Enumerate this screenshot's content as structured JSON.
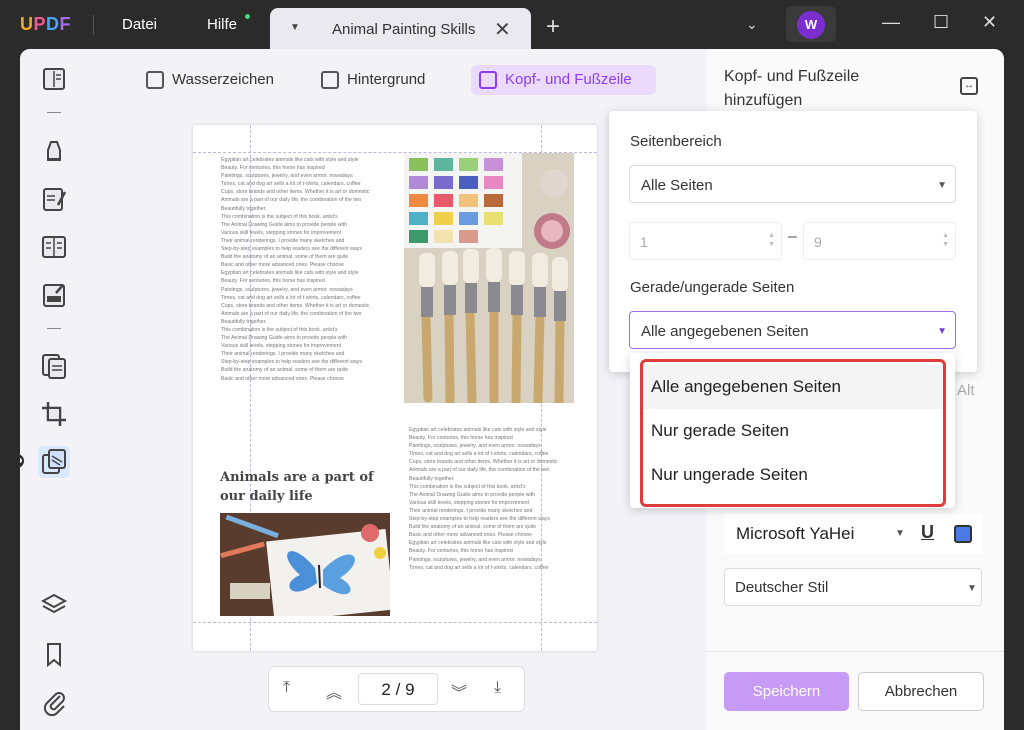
{
  "app": {
    "logo": "UPDF",
    "menu": [
      "Datei",
      "Hilfe"
    ],
    "tab_title": "Animal Painting Skills",
    "user_initial": "W"
  },
  "toolbar": {
    "watermark": "Wasserzeichen",
    "background": "Hintergrund",
    "header_footer": "Kopf- und Fußzeile"
  },
  "colors": {
    "accent": "#8a3ff0",
    "highlight_red": "#e03c3c",
    "save_button": "#c79af5"
  },
  "document": {
    "column_left_text": [
      "Egyptian art celebrates animals like cats with style and style",
      "Beauty. For centuries, this horse has inspired",
      "Paintings, sculptures, jewelry, and even armor. nowadays",
      "Times, cat and dog art sells a lot of t-shirts, calendars, coffee",
      "Cups, store brands and other items. Whether it is art or domestic",
      "Animals are a part of our daily life, the combination of the two",
      "Beautifully together.",
      "This combination is the subject of this book. artist's",
      "The Animal Drawing Guide aims to provide people with",
      "Various skill levels, stepping stones for improvement",
      "Their animal renderings. I provide many sketches and",
      "Step-by-step examples to help readers see the different ways",
      "Build the anatomy of an animal. some of them are quite",
      "Basic and other more advanced ones. Please choose",
      "Egyptian art celebrates animals like cats with style and style",
      "Beauty. For centuries, this horse has inspired",
      "Paintings, sculptures, jewelry, and even armor. nowadays",
      "Times, cat and dog art sells a lot of t-shirts, calendars, coffee",
      "Cups, store brands and other items. Whether it is art or domestic",
      "Animals are a part of our daily life, the combination of the two",
      "Beautifully together.",
      "This combination is the subject of this book. artist's",
      "The Animal Drawing Guide aims to provide people with",
      "Various skill levels, stepping stones for improvement",
      "Their animal renderings. I provide many sketches and",
      "Step-by-step examples to help readers see the different ways",
      "Build the anatomy of an animal. some of them are quite",
      "Basic and other more advanced ones. Please choose"
    ],
    "heading": "Animals are a part of our daily life",
    "column_right_text": [
      "Egyptian art celebrates animals like cats with style and style",
      "Beauty. For centuries, this horse has inspired",
      "Paintings, sculptures, jewelry, and even armor. nowadays",
      "Times, cat and dog art sells a lot of t-shirts, calendars, coffee",
      "Cups, store brands and other items. Whether it is art or domestic",
      "Animals are a part of our daily life, the combination of the two",
      "Beautifully together.",
      "This combination is the subject of this book. artist's",
      "The Animal Drawing Guide aims to provide people with",
      "Various skill levels, stepping stones for improvement",
      "Their animal renderings. I provide many sketches and",
      "Step-by-step examples to help readers see the different ways",
      "Build the anatomy of an animal. some of them are quite",
      "Basic and other more advanced ones. Please choose",
      "Egyptian art celebrates animals like cats with style and style",
      "Beauty. For centuries, this horse has inspired",
      "Paintings, sculptures, jewelry, and even armor. nowadays",
      "Times, cat and dog art sells a lot of t-shirts, calendars, coffee"
    ]
  },
  "pager": {
    "current": "2",
    "separator": "/",
    "total": "9"
  },
  "panel": {
    "title": "Kopf- und Fußzeile hinzufügen",
    "alt_label": "Alt",
    "font": "Microsoft YaHei",
    "underline": "U",
    "style": "Deutscher Stil",
    "save": "Speichern",
    "cancel": "Abbrechen"
  },
  "popup": {
    "range_label": "Seitenbereich",
    "range_value": "Alle Seiten",
    "from": "1",
    "to": "9",
    "dash": "–",
    "parity_label": "Gerade/ungerade Seiten",
    "parity_value": "Alle angegebenen Seiten",
    "options": [
      "Alle angegebenen Seiten",
      "Nur gerade Seiten",
      "Nur ungerade Seiten"
    ]
  }
}
